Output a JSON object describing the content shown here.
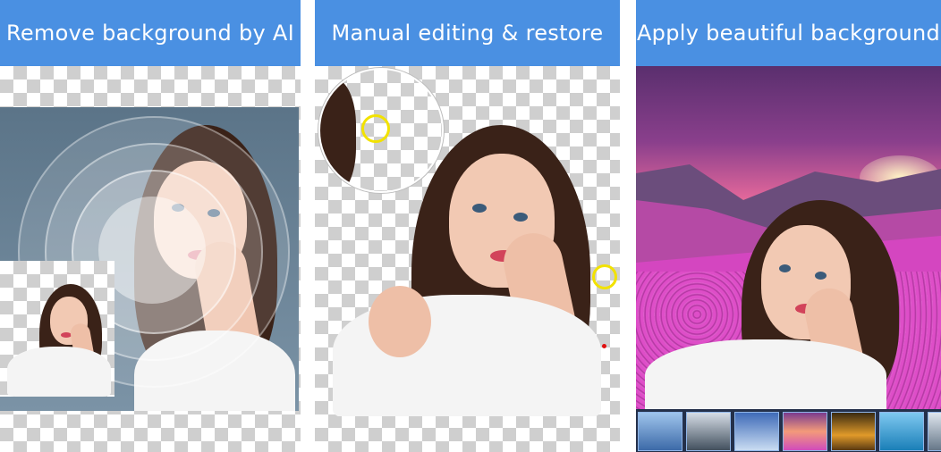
{
  "panels": [
    {
      "title": "Remove background by AI"
    },
    {
      "title": "Manual editing & restore"
    },
    {
      "title": "Apply beautiful background"
    }
  ],
  "colors": {
    "banner": "#4a90e2",
    "cursor_ring": "#f2e200",
    "brush_dot": "#e01010"
  },
  "background_thumbnails": [
    "pier-thumb",
    "mountain-thumb",
    "sky-thumb",
    "sunset-thumb",
    "forest-path-thumb",
    "sea-thumb",
    "extra-thumb"
  ]
}
